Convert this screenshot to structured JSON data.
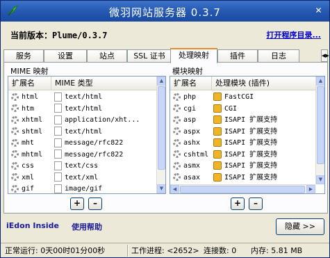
{
  "window": {
    "title": "微羽网站服务器 0.3.7"
  },
  "version": {
    "label": "当前版本：",
    "value": "Plume/0.3.7"
  },
  "open_dir_link": "打开程序目录...",
  "tabs": [
    "服务",
    "设置",
    "站点",
    "SSL 证书",
    "处理映射",
    "插件",
    "日志"
  ],
  "active_tab": "处理映射",
  "mime": {
    "group_title": "MIME 映射",
    "headers": [
      "扩展名",
      "MIME 类型"
    ],
    "rows": [
      [
        "html",
        "text/html"
      ],
      [
        "htm",
        "text/html"
      ],
      [
        "xhtml",
        "application/xht..."
      ],
      [
        "shtml",
        "text/html"
      ],
      [
        "mht",
        "message/rfc822"
      ],
      [
        "mhtml",
        "message/rfc822"
      ],
      [
        "css",
        "text/css"
      ],
      [
        "xml",
        "text/xml"
      ],
      [
        "gif",
        "image/gif"
      ]
    ],
    "add_label": "+",
    "remove_label": "–"
  },
  "modules": {
    "group_title": "模块映射",
    "headers": [
      "扩展名",
      "处理模块 (插件)"
    ],
    "rows": [
      [
        "php",
        "FastCGI"
      ],
      [
        "cgi",
        "CGI"
      ],
      [
        "asp",
        "ISAPI 扩展支持"
      ],
      [
        "aspx",
        "ISAPI 扩展支持"
      ],
      [
        "ashx",
        "ISAPI 扩展支持"
      ],
      [
        "cshtml",
        "ISAPI 扩展支持"
      ],
      [
        "asmx",
        "ISAPI 扩展支持"
      ],
      [
        "asax",
        "ISAPI 扩展支持"
      ]
    ],
    "add_label": "+",
    "remove_label": "–"
  },
  "footer": {
    "brand": "iEdon Inside",
    "help": "使用帮助",
    "hide_button": "隐藏 >>"
  },
  "status": {
    "uptime": "正常运行: 0天00时01分00秒",
    "process": "工作进程: <2652>",
    "connections": "连接数: 0",
    "memory": "内存: 5.81 MB"
  },
  "colors": {
    "titlebar": "#2457b0",
    "active_tab_accent": "#e68b2c",
    "link": "#0000cc"
  }
}
